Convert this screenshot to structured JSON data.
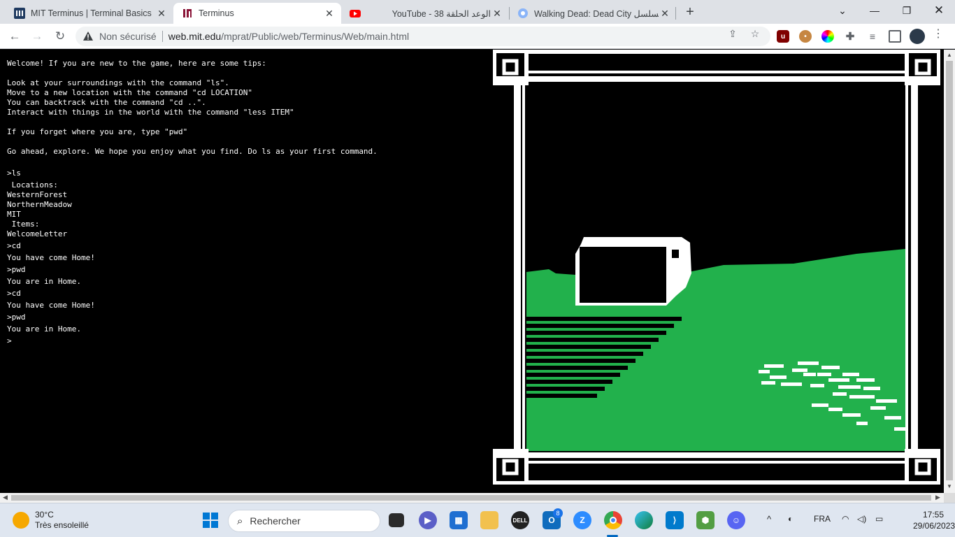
{
  "browser": {
    "tabs": [
      {
        "title": "MIT Terminus | Terminal Basics",
        "icon": "mit-favicon"
      },
      {
        "title": "Terminus",
        "icon": "mit-favicon"
      },
      {
        "title": "YouTube - 38 الوعد الحلقة",
        "icon": "youtube-favicon"
      },
      {
        "title": "Walking Dead: Dead City مسلسل",
        "icon": "globe-favicon"
      }
    ],
    "new_tab_label": "+",
    "window_controls": [
      "minimize",
      "restore",
      "close"
    ],
    "security_label": "Non sécurisé",
    "url_host": "web.mit.edu",
    "url_path": "/mprat/Public/web/Terminus/Web/main.html",
    "extensions": [
      "ublock-icon",
      "cookie-icon",
      "color-picker-icon",
      "puzzle-icon",
      "playlist-icon",
      "sidebar-icon",
      "profile-avatar"
    ]
  },
  "terminal": {
    "intro": [
      "Welcome! If you are new to the game, here are some tips:",
      "",
      "Look at your surroundings with the command \"ls\".",
      "Move to a new location with the command \"cd LOCATION\"",
      "You can backtrack with the command \"cd ..\".",
      "Interact with things in the world with the command \"less ITEM\"",
      "",
      "If you forget where you are, type \"pwd\"",
      "",
      "Go ahead, explore. We hope you enjoy what you find. Do ls as your first command."
    ],
    "session": [
      {
        "cmd": ">ls",
        "output": [
          " Locations:",
          "WesternForest",
          "NorthernMeadow",
          "MIT",
          " Items:",
          "WelcomeLetter"
        ]
      },
      {
        "cmd": ">cd",
        "output": [
          "You have come Home!"
        ]
      },
      {
        "cmd": ">pwd",
        "output": [
          "You are in Home."
        ]
      },
      {
        "cmd": ">cd",
        "output": [
          "You have come Home!"
        ]
      },
      {
        "cmd": ">pwd",
        "output": [
          "You are in Home."
        ]
      }
    ],
    "prompt": ">"
  },
  "scene": {
    "grass_color": "#22b14c",
    "frame_color": "#ffffff",
    "background_color": "#000000"
  },
  "taskbar": {
    "weather_temp": "30°C",
    "weather_desc": "Très ensoleillé",
    "search_placeholder": "Rechercher",
    "apps": [
      "windows-start-icon",
      "task-view-icon",
      "meet-icon",
      "store-icon",
      "file-explorer-icon",
      "dell-icon",
      "outlook-icon",
      "zoom-icon",
      "chrome-icon",
      "edge-icon",
      "vscode-icon",
      "nodejs-icon",
      "discord-icon"
    ],
    "notification_badge": "8",
    "language": "FRA",
    "time": "17:55",
    "date": "29/06/2023"
  }
}
